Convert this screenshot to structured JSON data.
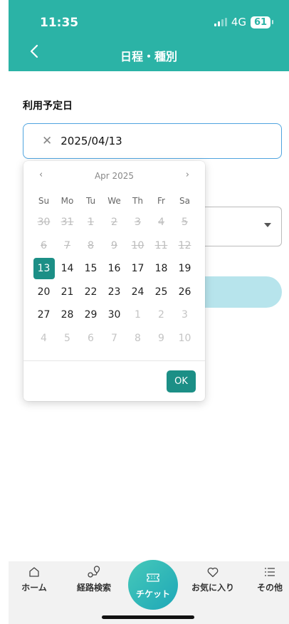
{
  "status_bar": {
    "time": "11:35",
    "network": "4G",
    "battery": "61"
  },
  "header": {
    "title": "日程・種別"
  },
  "form": {
    "date_label": "利用予定日",
    "date_value": "2025/04/13"
  },
  "picker": {
    "month_label": "Apr 2025",
    "weekdays": [
      "Su",
      "Mo",
      "Tu",
      "We",
      "Th",
      "Fr",
      "Sa"
    ],
    "days": [
      {
        "t": "30",
        "s": "disabled"
      },
      {
        "t": "31",
        "s": "disabled"
      },
      {
        "t": "1",
        "s": "disabled"
      },
      {
        "t": "2",
        "s": "disabled"
      },
      {
        "t": "3",
        "s": "disabled"
      },
      {
        "t": "4",
        "s": "disabled"
      },
      {
        "t": "5",
        "s": "disabled"
      },
      {
        "t": "6",
        "s": "disabled"
      },
      {
        "t": "7",
        "s": "disabled"
      },
      {
        "t": "8",
        "s": "disabled"
      },
      {
        "t": "9",
        "s": "disabled"
      },
      {
        "t": "10",
        "s": "disabled"
      },
      {
        "t": "11",
        "s": "disabled"
      },
      {
        "t": "12",
        "s": "disabled"
      },
      {
        "t": "13",
        "s": "selected"
      },
      {
        "t": "14",
        "s": "active"
      },
      {
        "t": "15",
        "s": "active"
      },
      {
        "t": "16",
        "s": "active"
      },
      {
        "t": "17",
        "s": "active"
      },
      {
        "t": "18",
        "s": "active"
      },
      {
        "t": "19",
        "s": "active"
      },
      {
        "t": "20",
        "s": "active"
      },
      {
        "t": "21",
        "s": "active"
      },
      {
        "t": "22",
        "s": "active"
      },
      {
        "t": "23",
        "s": "active"
      },
      {
        "t": "24",
        "s": "active"
      },
      {
        "t": "25",
        "s": "active"
      },
      {
        "t": "26",
        "s": "active"
      },
      {
        "t": "27",
        "s": "active"
      },
      {
        "t": "28",
        "s": "active"
      },
      {
        "t": "29",
        "s": "active"
      },
      {
        "t": "30",
        "s": "active"
      },
      {
        "t": "1",
        "s": "outside"
      },
      {
        "t": "2",
        "s": "outside"
      },
      {
        "t": "3",
        "s": "outside"
      },
      {
        "t": "4",
        "s": "outside"
      },
      {
        "t": "5",
        "s": "outside"
      },
      {
        "t": "6",
        "s": "outside"
      },
      {
        "t": "7",
        "s": "outside"
      },
      {
        "t": "8",
        "s": "outside"
      },
      {
        "t": "9",
        "s": "outside"
      },
      {
        "t": "10",
        "s": "outside"
      }
    ],
    "ok_label": "OK"
  },
  "tabbar": {
    "home": "ホーム",
    "route": "経路検索",
    "ticket": "チケット",
    "favorites": "お気に入り",
    "other": "その他"
  },
  "colors": {
    "header": "#2bb3a6",
    "accent": "#1c8f86",
    "focus_border": "#4fa4df"
  }
}
